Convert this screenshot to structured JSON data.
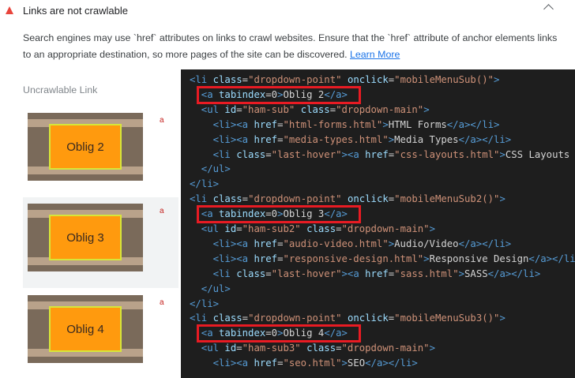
{
  "audit": {
    "title": "Links are not crawlable",
    "description": "Search engines may use `href` attributes on links to crawl websites. Ensure that the `href` attribute of anchor elements links to an appropriate destination, so more pages of the site can be discovered.",
    "learn_more": "Learn More",
    "column_label": "Uncrawlable Link",
    "status_color": "#e8453c"
  },
  "items": [
    {
      "button_text": "Oblig 2",
      "tag": "a"
    },
    {
      "button_text": "Oblig 3",
      "tag": "a"
    },
    {
      "button_text": "Oblig 4",
      "tag": "a"
    }
  ],
  "code": {
    "lines": [
      [
        {
          "c": "tag",
          "t": "<li "
        },
        {
          "c": "attr",
          "t": "class"
        },
        {
          "c": "txt",
          "t": "="
        },
        {
          "c": "str",
          "t": "\"dropdown-point\""
        },
        {
          "c": "txt",
          "t": " "
        },
        {
          "c": "attr",
          "t": "onclick"
        },
        {
          "c": "txt",
          "t": "="
        },
        {
          "c": "str",
          "t": "\"mobileMenuSub()\""
        },
        {
          "c": "tag",
          "t": ">"
        }
      ],
      [
        {
          "c": "tag",
          "t": "  <a "
        },
        {
          "c": "attr",
          "t": "tabindex"
        },
        {
          "c": "txt",
          "t": "=0"
        },
        {
          "c": "tag",
          "t": ">"
        },
        {
          "c": "txt",
          "t": "Oblig 2"
        },
        {
          "c": "tag",
          "t": "</a>"
        }
      ],
      [
        {
          "c": "tag",
          "t": "  <ul "
        },
        {
          "c": "attr",
          "t": "id"
        },
        {
          "c": "txt",
          "t": "="
        },
        {
          "c": "str",
          "t": "\"ham-sub\""
        },
        {
          "c": "txt",
          "t": " "
        },
        {
          "c": "attr",
          "t": "class"
        },
        {
          "c": "txt",
          "t": "="
        },
        {
          "c": "str",
          "t": "\"dropdown-main\""
        },
        {
          "c": "tag",
          "t": ">"
        }
      ],
      [
        {
          "c": "tag",
          "t": "    <li><a "
        },
        {
          "c": "attr",
          "t": "href"
        },
        {
          "c": "txt",
          "t": "="
        },
        {
          "c": "str",
          "t": "\"html-forms.html\""
        },
        {
          "c": "tag",
          "t": ">"
        },
        {
          "c": "txt",
          "t": "HTML Forms"
        },
        {
          "c": "tag",
          "t": "</a></li>"
        }
      ],
      [
        {
          "c": "tag",
          "t": "    <li><a "
        },
        {
          "c": "attr",
          "t": "href"
        },
        {
          "c": "txt",
          "t": "="
        },
        {
          "c": "str",
          "t": "\"media-types.html\""
        },
        {
          "c": "tag",
          "t": ">"
        },
        {
          "c": "txt",
          "t": "Media Types"
        },
        {
          "c": "tag",
          "t": "</a></li>"
        }
      ],
      [
        {
          "c": "tag",
          "t": "    <li "
        },
        {
          "c": "attr",
          "t": "class"
        },
        {
          "c": "txt",
          "t": "="
        },
        {
          "c": "str",
          "t": "\"last-hover\""
        },
        {
          "c": "tag",
          "t": "><a "
        },
        {
          "c": "attr",
          "t": "href"
        },
        {
          "c": "txt",
          "t": "="
        },
        {
          "c": "str",
          "t": "\"css-layouts.html\""
        },
        {
          "c": "tag",
          "t": ">"
        },
        {
          "c": "txt",
          "t": "CSS Layouts"
        }
      ],
      [
        {
          "c": "tag",
          "t": "  </ul>"
        }
      ],
      [
        {
          "c": "tag",
          "t": "</li>"
        }
      ],
      [
        {
          "c": "tag",
          "t": "<li "
        },
        {
          "c": "attr",
          "t": "class"
        },
        {
          "c": "txt",
          "t": "="
        },
        {
          "c": "str",
          "t": "\"dropdown-point\""
        },
        {
          "c": "txt",
          "t": " "
        },
        {
          "c": "attr",
          "t": "onclick"
        },
        {
          "c": "txt",
          "t": "="
        },
        {
          "c": "str",
          "t": "\"mobileMenuSub2()\""
        },
        {
          "c": "tag",
          "t": ">"
        }
      ],
      [
        {
          "c": "tag",
          "t": "  <a "
        },
        {
          "c": "attr",
          "t": "tabindex"
        },
        {
          "c": "txt",
          "t": "=0"
        },
        {
          "c": "tag",
          "t": ">"
        },
        {
          "c": "txt",
          "t": "Oblig 3"
        },
        {
          "c": "tag",
          "t": "</a>"
        }
      ],
      [
        {
          "c": "tag",
          "t": "  <ul "
        },
        {
          "c": "attr",
          "t": "id"
        },
        {
          "c": "txt",
          "t": "="
        },
        {
          "c": "str",
          "t": "\"ham-sub2\""
        },
        {
          "c": "txt",
          "t": " "
        },
        {
          "c": "attr",
          "t": "class"
        },
        {
          "c": "txt",
          "t": "="
        },
        {
          "c": "str",
          "t": "\"dropdown-main\""
        },
        {
          "c": "tag",
          "t": ">"
        }
      ],
      [
        {
          "c": "tag",
          "t": "    <li><a "
        },
        {
          "c": "attr",
          "t": "href"
        },
        {
          "c": "txt",
          "t": "="
        },
        {
          "c": "str",
          "t": "\"audio-video.html\""
        },
        {
          "c": "tag",
          "t": ">"
        },
        {
          "c": "txt",
          "t": "Audio/Video"
        },
        {
          "c": "tag",
          "t": "</a></li>"
        }
      ],
      [
        {
          "c": "tag",
          "t": "    <li><a "
        },
        {
          "c": "attr",
          "t": "href"
        },
        {
          "c": "txt",
          "t": "="
        },
        {
          "c": "str",
          "t": "\"responsive-design.html\""
        },
        {
          "c": "tag",
          "t": ">"
        },
        {
          "c": "txt",
          "t": "Responsive Design"
        },
        {
          "c": "tag",
          "t": "</a></li>"
        }
      ],
      [
        {
          "c": "tag",
          "t": "    <li "
        },
        {
          "c": "attr",
          "t": "class"
        },
        {
          "c": "txt",
          "t": "="
        },
        {
          "c": "str",
          "t": "\"last-hover\""
        },
        {
          "c": "tag",
          "t": "><a "
        },
        {
          "c": "attr",
          "t": "href"
        },
        {
          "c": "txt",
          "t": "="
        },
        {
          "c": "str",
          "t": "\"sass.html\""
        },
        {
          "c": "tag",
          "t": ">"
        },
        {
          "c": "txt",
          "t": "SASS"
        },
        {
          "c": "tag",
          "t": "</a></li>"
        }
      ],
      [
        {
          "c": "tag",
          "t": "  </ul>"
        }
      ],
      [
        {
          "c": "tag",
          "t": "</li>"
        }
      ],
      [
        {
          "c": "tag",
          "t": "<li "
        },
        {
          "c": "attr",
          "t": "class"
        },
        {
          "c": "txt",
          "t": "="
        },
        {
          "c": "str",
          "t": "\"dropdown-point\""
        },
        {
          "c": "txt",
          "t": " "
        },
        {
          "c": "attr",
          "t": "onclick"
        },
        {
          "c": "txt",
          "t": "="
        },
        {
          "c": "str",
          "t": "\"mobileMenuSub3()\""
        },
        {
          "c": "tag",
          "t": ">"
        }
      ],
      [
        {
          "c": "tag",
          "t": "  <a "
        },
        {
          "c": "attr",
          "t": "tabindex"
        },
        {
          "c": "txt",
          "t": "=0"
        },
        {
          "c": "tag",
          "t": ">"
        },
        {
          "c": "txt",
          "t": "Oblig 4"
        },
        {
          "c": "tag",
          "t": "</a>"
        }
      ],
      [
        {
          "c": "tag",
          "t": "  <ul "
        },
        {
          "c": "attr",
          "t": "id"
        },
        {
          "c": "txt",
          "t": "="
        },
        {
          "c": "str",
          "t": "\"ham-sub3\""
        },
        {
          "c": "txt",
          "t": " "
        },
        {
          "c": "attr",
          "t": "class"
        },
        {
          "c": "txt",
          "t": "="
        },
        {
          "c": "str",
          "t": "\"dropdown-main\""
        },
        {
          "c": "tag",
          "t": ">"
        }
      ],
      [
        {
          "c": "tag",
          "t": "    <li><a "
        },
        {
          "c": "attr",
          "t": "href"
        },
        {
          "c": "txt",
          "t": "="
        },
        {
          "c": "str",
          "t": "\"seo.html\""
        },
        {
          "c": "tag",
          "t": ">"
        },
        {
          "c": "txt",
          "t": "SEO"
        },
        {
          "c": "tag",
          "t": "</a></li>"
        }
      ]
    ],
    "highlight_lines": [
      1,
      9,
      17
    ]
  }
}
